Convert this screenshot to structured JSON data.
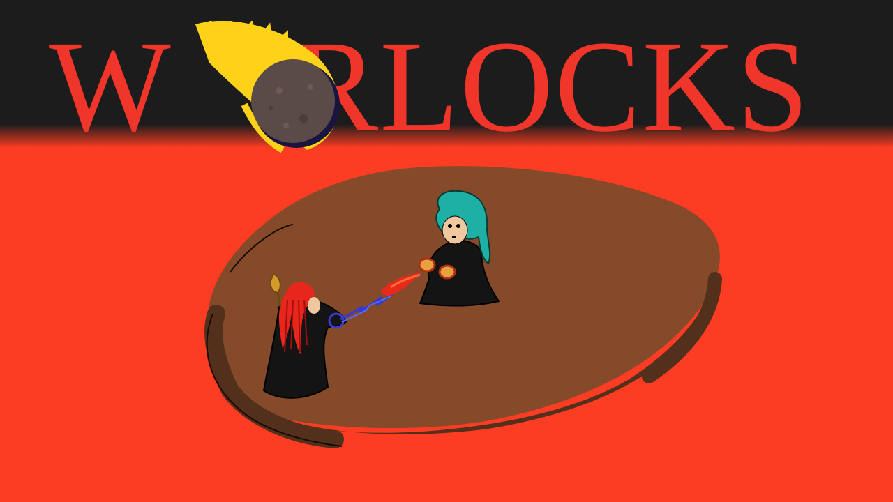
{
  "title": {
    "full_text": "WORLOCKS",
    "first_letter": "W",
    "rest": "RLOCKS",
    "meteor_icon": "meteor-icon"
  },
  "colors": {
    "lava": "#fc3c23",
    "sky": "#1c1c1c",
    "title": "#f0352a",
    "arena": "#844a2a",
    "arena_rim": "#53301c",
    "meteor_rock": "#5a4a48",
    "meteor_fire": "#ffd21a",
    "warlock_red_hair": "#e8261b",
    "warlock_teal_hair": "#1fb0a5",
    "robe": "#141414"
  },
  "scene": {
    "arena": "arena-platform",
    "characters": [
      "warlock-red-hair",
      "warlock-teal-hair"
    ],
    "spells": [
      "blue-lightning-spell",
      "fire-spell"
    ]
  }
}
